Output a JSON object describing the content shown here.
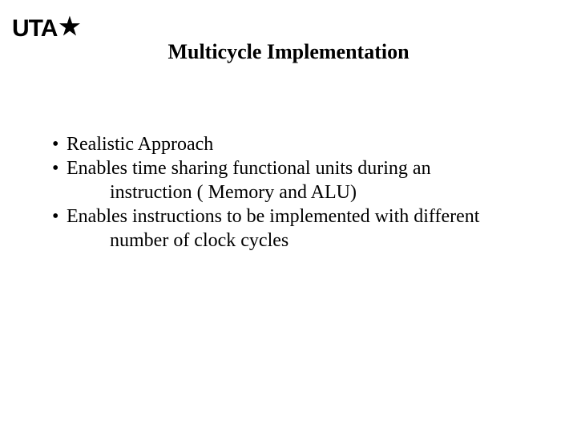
{
  "logo": {
    "text": "UTA",
    "star_glyph": "★"
  },
  "title": "Multicycle Implementation",
  "bullets": [
    {
      "mark": "•",
      "line1": "Realistic Approach"
    },
    {
      "mark": "•",
      "line1": "Enables time sharing functional units during an",
      "line2": "instruction ( Memory and ALU)"
    },
    {
      "mark": "•",
      "line1": "Enables instructions to be implemented with different",
      "line2": "number of clock cycles"
    }
  ]
}
